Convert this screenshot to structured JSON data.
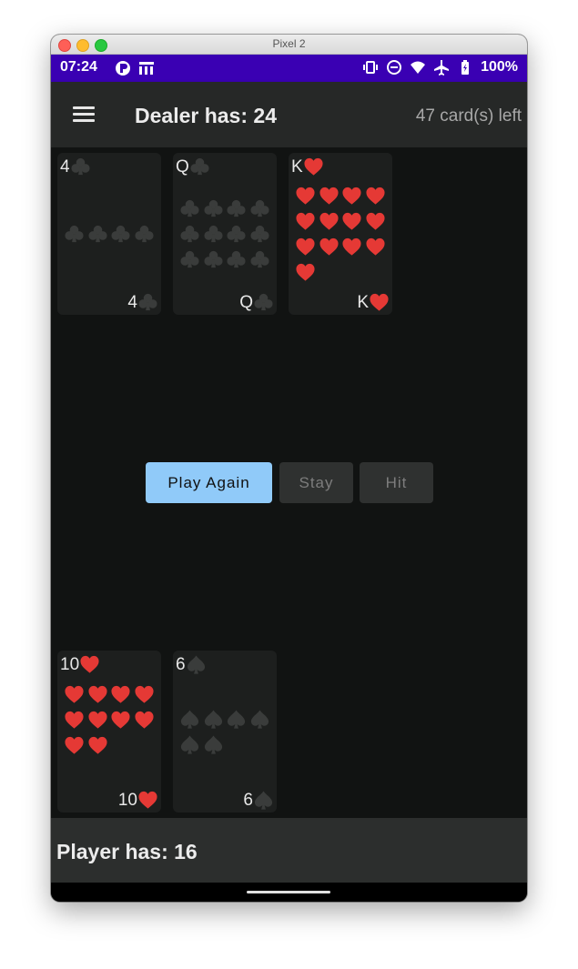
{
  "window": {
    "title": "Pixel 2"
  },
  "status": {
    "time": "07:24",
    "battery": "100%"
  },
  "appbar": {
    "title": "Dealer has: 24",
    "cards_left": "47 card(s) left"
  },
  "dealer_cards": [
    {
      "rank": "4",
      "suit": "clubs",
      "pips": 4
    },
    {
      "rank": "Q",
      "suit": "clubs",
      "pips": 12
    },
    {
      "rank": "K",
      "suit": "hearts",
      "pips": 13
    }
  ],
  "player_cards": [
    {
      "rank": "10",
      "suit": "hearts",
      "pips": 10
    },
    {
      "rank": "6",
      "suit": "spades",
      "pips": 6
    }
  ],
  "buttons": {
    "play_again": "Play Again",
    "stay": "Stay",
    "hit": "Hit"
  },
  "player": {
    "title": "Player has: 16"
  },
  "colors": {
    "heart": "#e53935",
    "dark_suit": "#3a3c3b",
    "primary": "#90caf9",
    "status_bar": "#3a00b3"
  }
}
